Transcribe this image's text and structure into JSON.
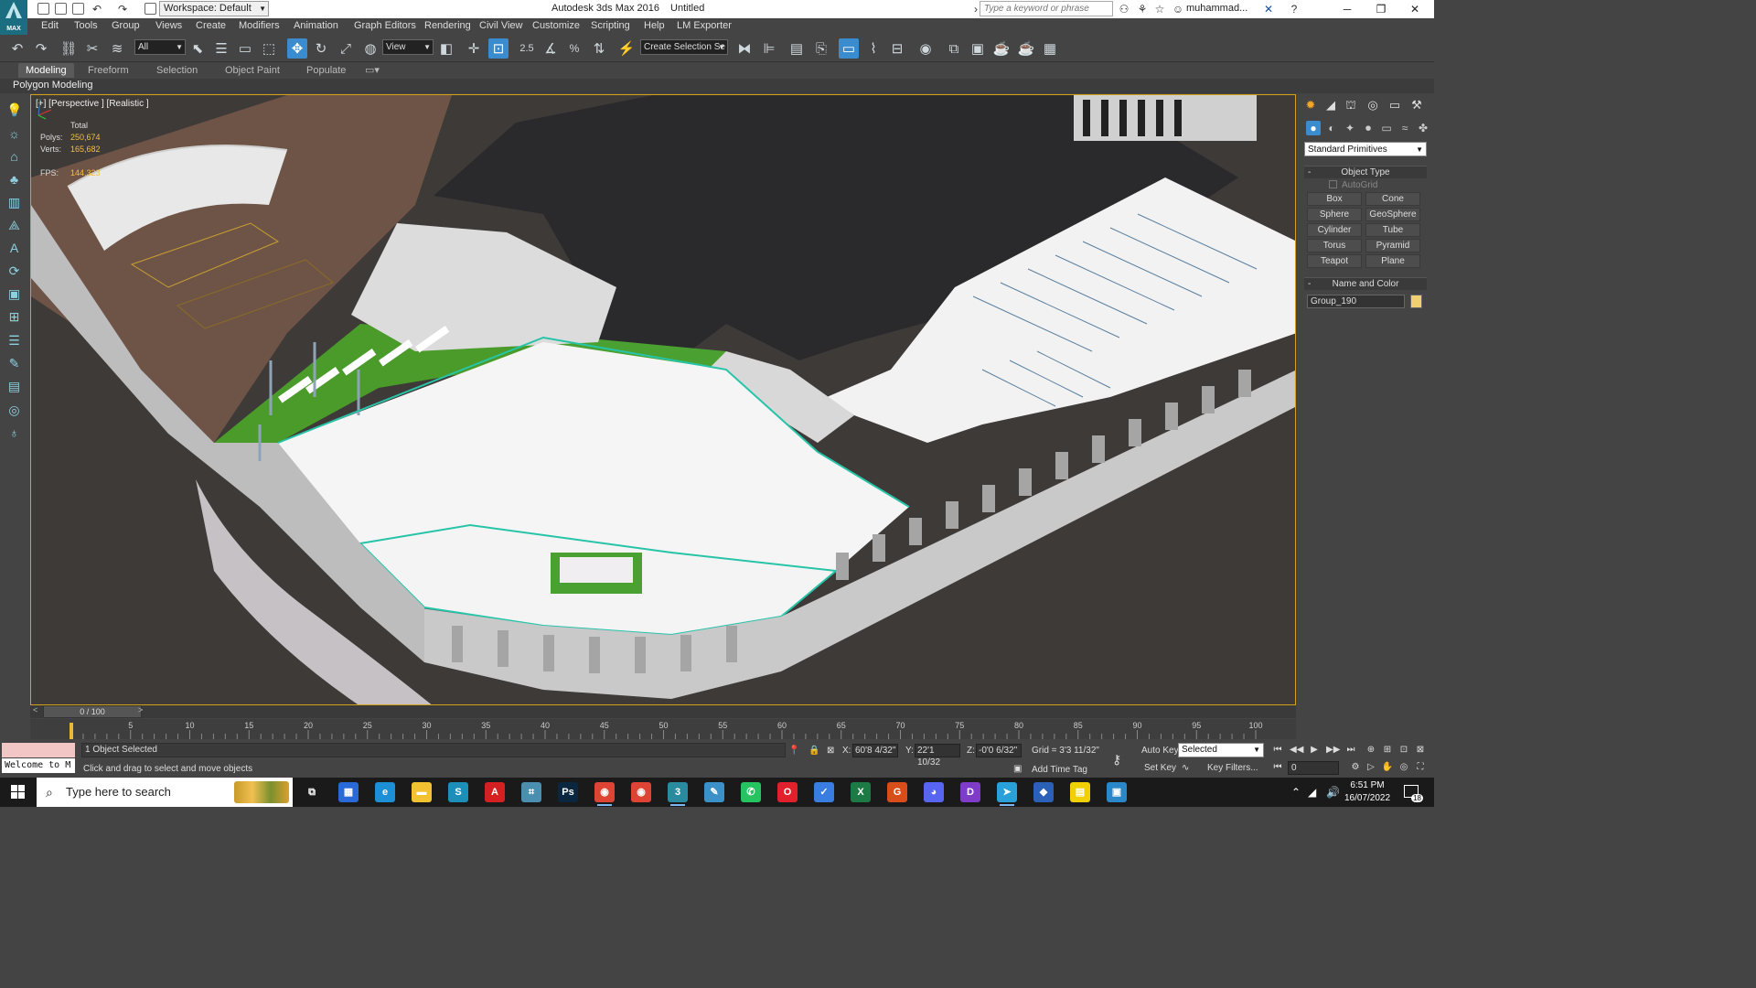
{
  "titlebar": {
    "logo_text": "MAX",
    "workspace": "Workspace: Default",
    "app_name": "Autodesk 3ds Max 2016",
    "document": "Untitled",
    "search_placeholder": "Type a keyword or phrase",
    "user": "muhammad...",
    "window_controls": [
      "minimize-icon",
      "restore-icon",
      "close-icon"
    ]
  },
  "menu": [
    "Edit",
    "Tools",
    "Group",
    "Views",
    "Create",
    "Modifiers",
    "Animation",
    "Graph Editors",
    "Rendering",
    "Civil View",
    "Customize",
    "Scripting",
    "Help",
    "LM Exporter"
  ],
  "toolbar": {
    "selection_filter": "All",
    "ref_coord": "View",
    "named_selection": "Create Selection Se",
    "snap_label": "2.5",
    "angle_snap_label": "%"
  },
  "ribbon": {
    "tabs": [
      "Modeling",
      "Freeform",
      "Selection",
      "Object Paint",
      "Populate"
    ],
    "active_tab": "Modeling",
    "sub_label": "Polygon Modeling"
  },
  "viewport": {
    "label": "[+] [Perspective ] [Realistic ]",
    "stats": {
      "total_label": "Total",
      "polys_label": "Polys:",
      "polys": "250,674",
      "verts_label": "Verts:",
      "verts": "165,682",
      "fps_label": "FPS:",
      "fps": "144.323"
    }
  },
  "command_panel": {
    "primitive_type": "Standard Primitives",
    "object_type_title": "Object Type",
    "autogrid": "AutoGrid",
    "primitives": [
      "Box",
      "Cone",
      "Sphere",
      "GeoSphere",
      "Cylinder",
      "Tube",
      "Torus",
      "Pyramid",
      "Teapot",
      "Plane"
    ],
    "name_color_title": "Name and Color",
    "object_name": "Group_190",
    "object_color": "#f0d070"
  },
  "timeline": {
    "frame_display": "0 / 100",
    "ticks": [
      "5",
      "10",
      "15",
      "20",
      "25",
      "30",
      "35",
      "40",
      "45",
      "50",
      "55",
      "60",
      "65",
      "70",
      "75",
      "80",
      "85",
      "90",
      "95",
      "100"
    ]
  },
  "status": {
    "maxscript": "Welcome to M",
    "selection": "1 Object Selected",
    "prompt": "Click and drag to select and move objects",
    "x_label": "X:",
    "x": "60'8 4/32\"",
    "y_label": "Y:",
    "y": "22'1 10/32",
    "z_label": "Z:",
    "z": "-0'0 6/32\"",
    "grid": "Grid = 3'3 11/32\"",
    "add_time_tag": "Add Time Tag",
    "auto_key": "Auto Key",
    "set_key": "Set Key",
    "key_mode": "Selected",
    "key_filters": "Key Filters...",
    "current_frame": "0"
  },
  "taskbar": {
    "search_placeholder": "Type here to search",
    "time": "6:51 PM",
    "date": "16/07/2022",
    "notifications": "18",
    "apps": [
      {
        "name": "task-view",
        "label": "⧉",
        "color": "#1a1a1a"
      },
      {
        "name": "calculator",
        "label": "▦",
        "color": "#2a6ad8"
      },
      {
        "name": "edge",
        "label": "e",
        "color": "#1d8fd6"
      },
      {
        "name": "file-explorer",
        "label": "▬",
        "color": "#f2c230"
      },
      {
        "name": "app-s",
        "label": "S",
        "color": "#1b8fb8"
      },
      {
        "name": "acrobat",
        "label": "A",
        "color": "#d42020"
      },
      {
        "name": "app-grid",
        "label": "⌗",
        "color": "#4b8fb0"
      },
      {
        "name": "photoshop",
        "label": "Ps",
        "color": "#0b2740"
      },
      {
        "name": "chrome-1",
        "label": "◉",
        "color": "#dd4433"
      },
      {
        "name": "chrome-2",
        "label": "◉",
        "color": "#dd4433"
      },
      {
        "name": "3dsmax",
        "label": "3",
        "color": "#2a8aa0"
      },
      {
        "name": "notes",
        "label": "✎",
        "color": "#3c90c8"
      },
      {
        "name": "whatsapp",
        "label": "✆",
        "color": "#25c460"
      },
      {
        "name": "opera",
        "label": "O",
        "color": "#e0202a"
      },
      {
        "name": "todo",
        "label": "✓",
        "color": "#3a7de0"
      },
      {
        "name": "excel",
        "label": "X",
        "color": "#1d7a45"
      },
      {
        "name": "grammarly",
        "label": "G",
        "color": "#d84d1a"
      },
      {
        "name": "discord",
        "label": "◕",
        "color": "#5865f2"
      },
      {
        "name": "app-d",
        "label": "D",
        "color": "#7e3cc8"
      },
      {
        "name": "telegram",
        "label": "➤",
        "color": "#2aa0d8"
      },
      {
        "name": "app-cube",
        "label": "◆",
        "color": "#2a60b8"
      },
      {
        "name": "sticky-notes",
        "label": "▤",
        "color": "#f0d000"
      },
      {
        "name": "photos",
        "label": "▣",
        "color": "#2a88c8"
      }
    ]
  }
}
